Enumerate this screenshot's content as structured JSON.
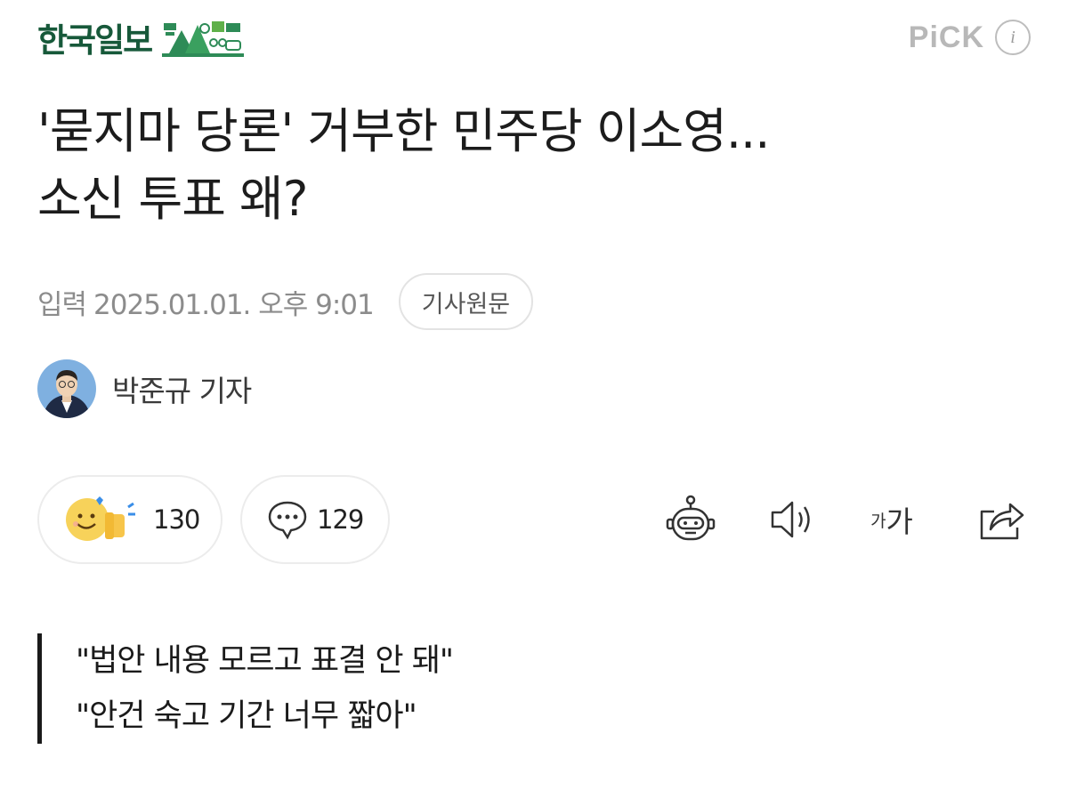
{
  "header": {
    "logo_text": "한국일보",
    "logo_brand_color": "#17593a",
    "pick_text": "PiCK",
    "info_icon": "info-icon"
  },
  "article": {
    "title_line1": "'묻지마 당론' 거부한 민주당 이소영...",
    "title_line2": "소신 투표 왜?",
    "published_label": "입력",
    "published_at": "2025.01.01. 오후 9:01",
    "original_button": "기사원문"
  },
  "reporter": {
    "name": "박준규 기자",
    "avatar_icon": "reporter-avatar"
  },
  "actions": {
    "reaction_count": "130",
    "comment_count": "129",
    "font_small": "가",
    "font_big": "가"
  },
  "quote": {
    "line1": "\"법안 내용 모르고 표결 안 돼\"",
    "line2": "\"안건 숙고 기간 너무 짧아\""
  }
}
